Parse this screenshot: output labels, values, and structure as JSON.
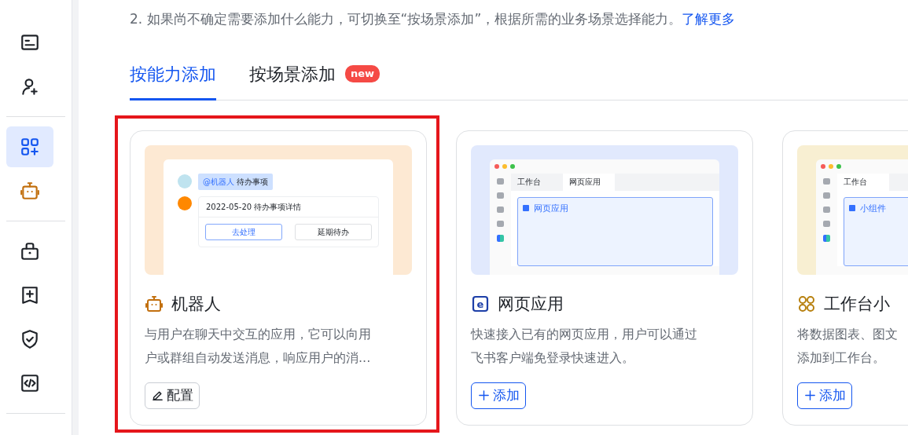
{
  "sidebar": {
    "groups": [
      {
        "items": [
          {
            "kind": "list-box",
            "selected": false
          },
          {
            "kind": "user-add",
            "selected": false
          }
        ]
      },
      {
        "items": [
          {
            "kind": "apps-add",
            "selected": true
          },
          {
            "kind": "robot",
            "selected": false
          }
        ]
      },
      {
        "items": [
          {
            "kind": "toolbox",
            "selected": false
          },
          {
            "kind": "bookmark-add",
            "selected": false
          },
          {
            "kind": "shield-check",
            "selected": false
          },
          {
            "kind": "code",
            "selected": false
          }
        ]
      }
    ]
  },
  "intro": {
    "text": "2. 如果尚不确定需要添加什么能力，可切换至“按场景添加”，根据所需的业务场景选择能力。",
    "link": "了解更多"
  },
  "tabs": [
    {
      "label": "按能力添加",
      "selected": true
    },
    {
      "label": "按场景添加",
      "selected": false,
      "badge": "new"
    }
  ],
  "cards": [
    {
      "kind": "bot",
      "highlighted": true,
      "title": "机器人",
      "description_lines": [
        "与用户在聊天中交互的应用，它可以向用",
        "户或群组自动发送消息，响应用户的消..."
      ],
      "button": {
        "kind": "edit",
        "label": "配置"
      },
      "preview": {
        "kind": "chat",
        "mention": "@机器人",
        "message": "待办事项",
        "detail": "2022-05-20 待办事项详情",
        "actions": [
          {
            "label": "去处理",
            "primary": true
          },
          {
            "label": "延期待办",
            "primary": false
          }
        ]
      }
    },
    {
      "kind": "web",
      "highlighted": false,
      "icon_text": "e",
      "title": "网页应用",
      "description_lines": [
        "快速接入已有的网页应用，用户可以通过",
        "飞书客户端免登录快速进入。"
      ],
      "button": {
        "kind": "add",
        "label": "添加"
      },
      "preview": {
        "kind": "window",
        "tabs": [
          {
            "label": "工作台",
            "selected": false
          },
          {
            "label": "网页应用",
            "selected": true
          }
        ],
        "panel": "网页应用"
      }
    },
    {
      "kind": "widget",
      "highlighted": false,
      "title": "工作台小",
      "description_lines": [
        "将数据图表、图文",
        "添加到工作台。"
      ],
      "button": {
        "kind": "add",
        "label": "添加"
      },
      "preview": {
        "kind": "window",
        "tabs": [
          {
            "label": "工作台",
            "selected": true
          }
        ],
        "panel": "小组件"
      }
    }
  ]
}
